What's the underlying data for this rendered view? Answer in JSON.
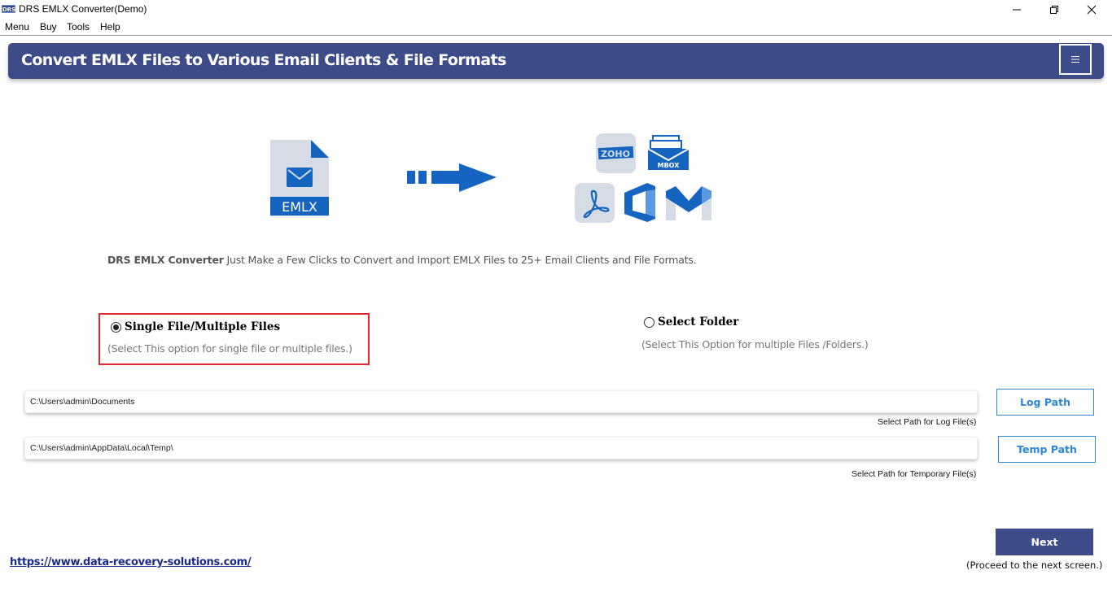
{
  "window": {
    "app_icon_text": "DRS",
    "title": "DRS EMLX Converter(Demo)",
    "controls": {
      "minimize": "minimize",
      "restore": "restore",
      "close": "close"
    }
  },
  "menubar": {
    "items": [
      {
        "label": "Menu"
      },
      {
        "label": "Buy"
      },
      {
        "label": "Tools"
      },
      {
        "label": "Help"
      }
    ]
  },
  "header": {
    "title": "Convert EMLX Files to Various Email Clients & File Formats",
    "menu_icon": "hamburger-icon"
  },
  "hero": {
    "source_label": "EMLX",
    "source_icon": "emlx-file-icon",
    "arrow_icon": "arrow-right-icon",
    "targets": [
      {
        "name": "zoho",
        "label": "ZOHO"
      },
      {
        "name": "mbox",
        "label": "MBOX"
      },
      {
        "name": "pdf",
        "label": ""
      },
      {
        "name": "office",
        "label": ""
      },
      {
        "name": "gmail",
        "label": ""
      }
    ],
    "colors": {
      "primary": "#1565c0",
      "tile": "#d6dce6"
    }
  },
  "description": {
    "brand": "DRS EMLX Converter",
    "text": " Just Make a Few Clicks to Convert and Import EMLX Files to 25+ Email Clients and File Formats."
  },
  "options": {
    "single": {
      "label": "Single File/Multiple Files",
      "hint": "(Select This option for single file or multiple files.)",
      "selected": true
    },
    "folder": {
      "label": "Select Folder",
      "hint": "(Select This Option for multiple Files /Folders.)",
      "selected": false
    }
  },
  "paths": {
    "log": {
      "value": "C:\\Users\\admin\\Documents",
      "caption": "Select Path for Log File(s)",
      "button": "Log Path"
    },
    "temp": {
      "value": "C:\\Users\\admin\\AppData\\Local\\Temp\\",
      "caption": "Select Path for Temporary File(s)",
      "button": "Temp Path"
    }
  },
  "footer": {
    "link": "https://www.data-recovery-solutions.com/",
    "next_label": "Next",
    "next_hint": "(Proceed to the next screen.)"
  },
  "theme": {
    "header_bg": "#3d4c88",
    "highlight_border": "#e02a2f",
    "button_accent": "#2d86d6"
  }
}
